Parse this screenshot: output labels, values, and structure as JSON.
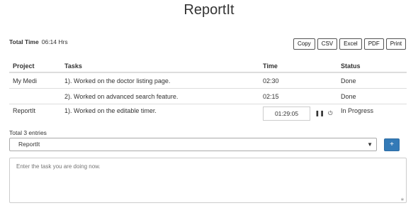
{
  "app": {
    "title": "ReportIt"
  },
  "summary": {
    "total_time_label": "Total Time",
    "total_time_value": "06:14 Hrs",
    "total_entries": "Total 3 entries"
  },
  "export_buttons": [
    "Copy",
    "CSV",
    "Excel",
    "PDF",
    "Print"
  ],
  "table": {
    "headers": [
      "Project",
      "Tasks",
      "Time",
      "Status"
    ],
    "rows": [
      {
        "project": "My Medi",
        "task": "1). Worked on the doctor listing page.",
        "time": "02:30",
        "status": "Done"
      },
      {
        "project": "",
        "task": "2). Worked on advanced search feature.",
        "time": "02:15",
        "status": "Done"
      },
      {
        "project": "ReportIt",
        "task": "1). Worked on the editable timer.",
        "time": "01:29:05",
        "status": "In Progress"
      }
    ]
  },
  "form": {
    "project_select": "ReportIt",
    "add_button": "+",
    "task_placeholder": "Enter the task you are doing now."
  },
  "icons": {
    "pause": "pause-icon",
    "reset": "power-icon",
    "dropdown": "caret-down-icon"
  }
}
